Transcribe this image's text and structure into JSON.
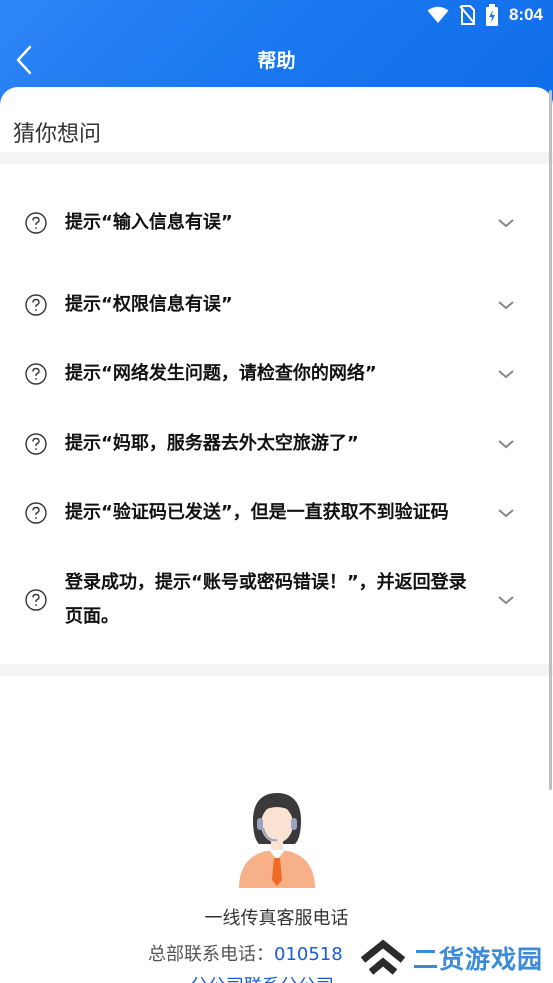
{
  "status_bar": {
    "time": "8:04"
  },
  "header": {
    "title": "帮助"
  },
  "section": {
    "title": "猜你想问"
  },
  "faq": [
    {
      "question": "提示“输入信息有误”"
    },
    {
      "question": "提示“权限信息有误”"
    },
    {
      "question": "提示“网络发生问题，请检查你的网络”"
    },
    {
      "question": "提示“妈耶，服务器去外太空旅游了”"
    },
    {
      "question": "提示“验证码已发送”，但是一直获取不到验证码"
    },
    {
      "question": "登录成功，提示“账号或密码错误！”，并返回登录页面。"
    }
  ],
  "service": {
    "title": "一线传真客服电话",
    "phone_label": "总部联系电话：",
    "phone_number": "010518",
    "branch_text": "分公司联系分公司"
  },
  "watermark": {
    "text": "二货游戏园"
  },
  "colors": {
    "header": "#1a78f0",
    "link": "#1a5bd8",
    "avatar_shirt": "#f7b087",
    "avatar_tie": "#f06a24"
  }
}
